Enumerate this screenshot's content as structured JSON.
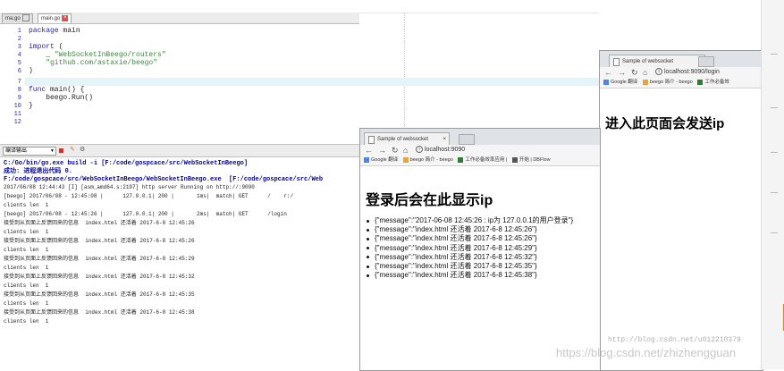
{
  "ide": {
    "tabs": [
      "ma.go",
      "main.go"
    ],
    "line_numbers": [
      "1",
      "2",
      "3",
      "4",
      "5",
      "6",
      "7",
      "8",
      "9",
      "10",
      "11",
      "12"
    ],
    "code": {
      "l1_kw": "package",
      "l1_rest": " main",
      "l3_kw": "import",
      "l3_rest": " (",
      "l4_prefix": "    _ ",
      "l4_str": "\"WebSocketInBeego/routers\"",
      "l5_str": "    \"github.com/astaxie/beego\"",
      "l6": ")",
      "l8_kw": "func",
      "l8_rest": " main() {",
      "l9": "    beego.Run()",
      "l10": "}"
    }
  },
  "console": {
    "select_label": "编译输出",
    "lines": [
      "C:/Go/bin/go.exe build -i [F:/code/gospcace/src/WebSocketInBeego]",
      "成功: 进程退出代码 0.",
      "F:/code/gospcace/src/WebSocketInBeego/WebSocketInBeego.exe  [F:/code/gospcace/src/Web",
      "2017/06/08 12:44:43 [I] [asm_amd64.s:2197] http server Running on http://:9090",
      "[beego] 2017/06/08 - 12:45:08 |      127.0.0.1| 200 |       1ms|  match| GET      /    r:/",
      "clients len  1",
      "[beego] 2017/06/08 - 12:45:26 |      127.0.0.1| 200 |       2ms|  match| GET      /login",
      "接受到从页面上反馈回来的信息  index.html 还活着 2017-6-8 12:45:26",
      "clients len  1",
      "接受到从页面上反馈回来的信息  index.html 还活着 2017-6-8 12:45:26",
      "clients len  1",
      "接受到从页面上反馈回来的信息  index.html 还活着 2017-6-8 12:45:29",
      "clients len  1",
      "接受到从页面上反馈回来的信息  index.html 还活着 2017-6-8 12:45:32",
      "clients len  1",
      "接受到从页面上反馈回来的信息  index.html 还活着 2017-6-8 12:45:35",
      "clients len  1",
      "接受到从页面上反馈回来的信息  index.html 还活着 2017-6-8 12:45:38",
      "clients len  1"
    ]
  },
  "browser_main": {
    "tab_title": "Sample of websocket",
    "url": "localhost:9090",
    "bookmarks": [
      "Google 翻译",
      "beego 简介 - beego",
      "工作必备效率应用 |",
      "开始 | DBFlow"
    ],
    "heading": "登录后会在此显示ip",
    "messages": [
      "{\"message\":\"2017-06-08 12:45:26 : ip为 127.0.0.1的用户登录\"}",
      "{\"message\":\"index.html 还活着 2017-6-8 12:45:26\"}",
      "{\"message\":\"index.html 还活着 2017-6-8 12:45:26\"}",
      "{\"message\":\"index.html 还活着 2017-6-8 12:45:29\"}",
      "{\"message\":\"index.html 还活着 2017-6-8 12:45:32\"}",
      "{\"message\":\"index.html 还活着 2017-6-8 12:45:35\"}",
      "{\"message\":\"index.html 还活着 2017-6-8 12:45:38\"}"
    ]
  },
  "browser_login": {
    "tab_title": "Sample of websocket",
    "url": "localhost:9090/login",
    "bookmarks": [
      "Google 翻译",
      "beego 简介 - beego",
      "工作必备效"
    ],
    "heading": "进入此页面会发送ip"
  },
  "watermarks": {
    "small": "http://blog.csdn.net/u012210379",
    "large": "https://blog.csdn.net/zhizhengguan"
  },
  "colors": {
    "keyword": "#1f1fb8",
    "string": "#3a8a3a",
    "line_highlight": "#e4f4f8",
    "tab_close": "#d9534f",
    "stop": "#c0392b"
  }
}
